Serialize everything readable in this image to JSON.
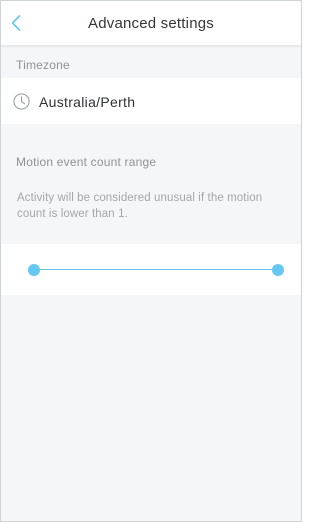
{
  "header": {
    "title": "Advanced settings"
  },
  "timezone": {
    "section_label": "Timezone",
    "value": "Australia/Perth"
  },
  "motion": {
    "section_label": "Motion event count range",
    "description": "Activity will be considered unusual if the motion count is lower than 1."
  },
  "colors": {
    "accent": "#66c8f2",
    "background": "#f5f6f8",
    "card": "#ffffff"
  },
  "icons": {
    "back": "chevron-left-icon",
    "timezone": "clock-icon"
  }
}
